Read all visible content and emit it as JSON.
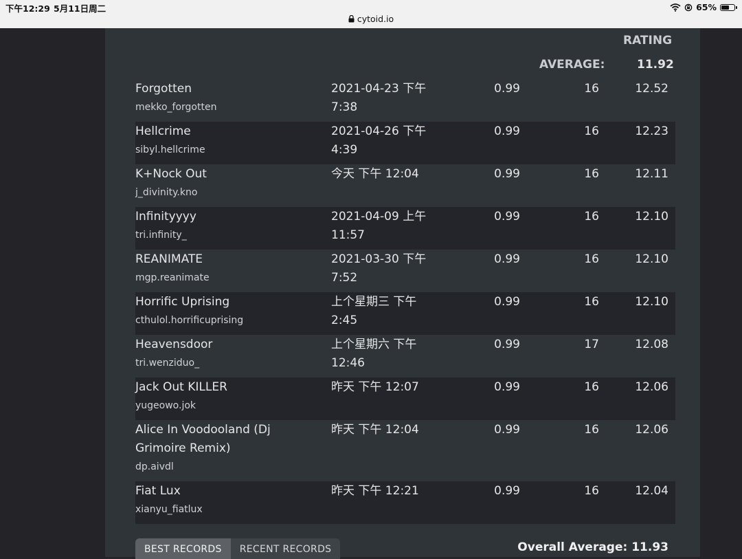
{
  "status_bar": {
    "time": "下午12:29",
    "date": "5月11日周二",
    "url": "cytoid.io",
    "battery": "65%",
    "battery_level": 0.65
  },
  "table": {
    "header_rating": "RATING",
    "average_label": "AVERAGE:",
    "average_value": "11.92",
    "rows": [
      {
        "title": "Forgotten",
        "id": "mekko_forgotten",
        "date": "2021-04-23 下午\n7:38",
        "accuracy": "0.99",
        "level": "16",
        "rating": "12.52"
      },
      {
        "title": "Hellcrime",
        "id": "sibyl.hellcrime",
        "date": "2021-04-26 下午\n4:39",
        "accuracy": "0.99",
        "level": "16",
        "rating": "12.23"
      },
      {
        "title": "K+Nock Out",
        "id": "j_divinity.kno",
        "date": "今天 下午 12:04",
        "accuracy": "0.99",
        "level": "16",
        "rating": "12.11"
      },
      {
        "title": "Infinityyyy",
        "id": "tri.infinity_",
        "date": "2021-04-09 上午\n11:57",
        "accuracy": "0.99",
        "level": "16",
        "rating": "12.10"
      },
      {
        "title": "REANIMATE",
        "id": "mgp.reanimate",
        "date": "2021-03-30 下午\n7:52",
        "accuracy": "0.99",
        "level": "16",
        "rating": "12.10"
      },
      {
        "title": "Horrific Uprising",
        "id": "cthulol.horrificuprising",
        "date": "上个星期三 下午\n2:45",
        "accuracy": "0.99",
        "level": "16",
        "rating": "12.10"
      },
      {
        "title": "Heavensdoor",
        "id": "tri.wenziduo_",
        "date": "上个星期六 下午\n12:46",
        "accuracy": "0.99",
        "level": "17",
        "rating": "12.08"
      },
      {
        "title": "Jack Out KILLER",
        "id": "yugeowo.jok",
        "date": "昨天 下午 12:07",
        "accuracy": "0.99",
        "level": "16",
        "rating": "12.06"
      },
      {
        "title": "Alice In Voodooland (Dj Grimoire Remix)",
        "id": "dp.aivdl",
        "date": "昨天 下午 12:04",
        "accuracy": "0.99",
        "level": "16",
        "rating": "12.06"
      },
      {
        "title": "Fiat Lux",
        "id": "xianyu_fiatlux",
        "date": "昨天 下午 12:21",
        "accuracy": "0.99",
        "level": "16",
        "rating": "12.04"
      }
    ]
  },
  "tabs": {
    "best": "BEST RECORDS",
    "recent": "RECENT RECORDS"
  },
  "overall_average": "Overall Average: 11.93"
}
